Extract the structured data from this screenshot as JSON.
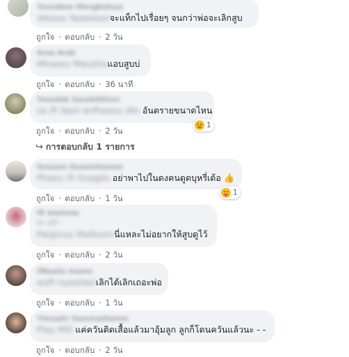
{
  "comments": [
    {
      "author": "Yoosakee Mongkolsuo",
      "blurred_prefix": "ฟสนนน Yaoaasuo",
      "text": "จะแท็กไปเรื่อยๆ จนกว่าพ่อจะเลิกสูบ",
      "like": "ถูกใจ",
      "reply": "ตอบกลับ",
      "time": "2 วัน"
    },
    {
      "author": "Araa Arak",
      "blurred_prefix": "Mhaasu Maustia",
      "text": "แอบสูบบ่",
      "like": "ถูกใจ",
      "reply": "ตอบกลับ",
      "time": "36 นาที"
    },
    {
      "author": "Yasudak Sasakitkhon",
      "blurred_prefix": "sa ifi llasil anfhaasu dtn",
      "text": "อันตรายขนาดไหน",
      "like": "ถูกใจ",
      "reply": "ตอบกลับ",
      "time": "2 วัน",
      "reaction_count": "1"
    },
    {
      "author": "Oouaon Ouaaiohaomn",
      "blurred_prefix": "Phaou ifi Ouaglis",
      "text": "อย่าพาไปในดงคนดูดบุหรี่เด้อ 👍",
      "like": "ถูกใจ",
      "reply": "ตอบกลับ",
      "time": "1 วัน",
      "reaction_count": "1"
    },
    {
      "author": "ifi wasiuoa",
      "blurred_prefix": "Paiginuo Maifuom",
      "text": "นี่แหละไม่อยากให้สูบดูไว้",
      "like": "ถูกใจ",
      "reply": "ตอบกลับ",
      "time": "2 วัน"
    },
    {
      "author": "ifBaalis mamn",
      "blurred_prefix": "asifi nyaoliasi",
      "text": "เลิกได้เลิกเถอะพ่อ",
      "like": "ถูกใจ",
      "reply": "ตอบกลับ",
      "time": "1 วัน"
    },
    {
      "author": "Yimuahi Yoasouaitamm",
      "blurred_prefix": "Play Mill",
      "text": "แค่ควันติดเสื้อแล้วมาอุ้มลูก ลูกก็โดนควันแล้วนะ - -",
      "like": "ถูกใจ",
      "reply": "ตอบกลับ",
      "time": "2 วัน"
    }
  ],
  "replies_link": "การตอบกลับ 1 รายการ",
  "separator": "·",
  "icons": {
    "reply_arrow": "reply-arrow-icon",
    "sad": "sad-reaction-icon",
    "love": "care-reaction-icon",
    "thumbs": "thumbs-up-emoji"
  },
  "colors": {
    "bubble": "#f0f2f5",
    "meta": "#65676b",
    "text": "#1c1e21"
  }
}
